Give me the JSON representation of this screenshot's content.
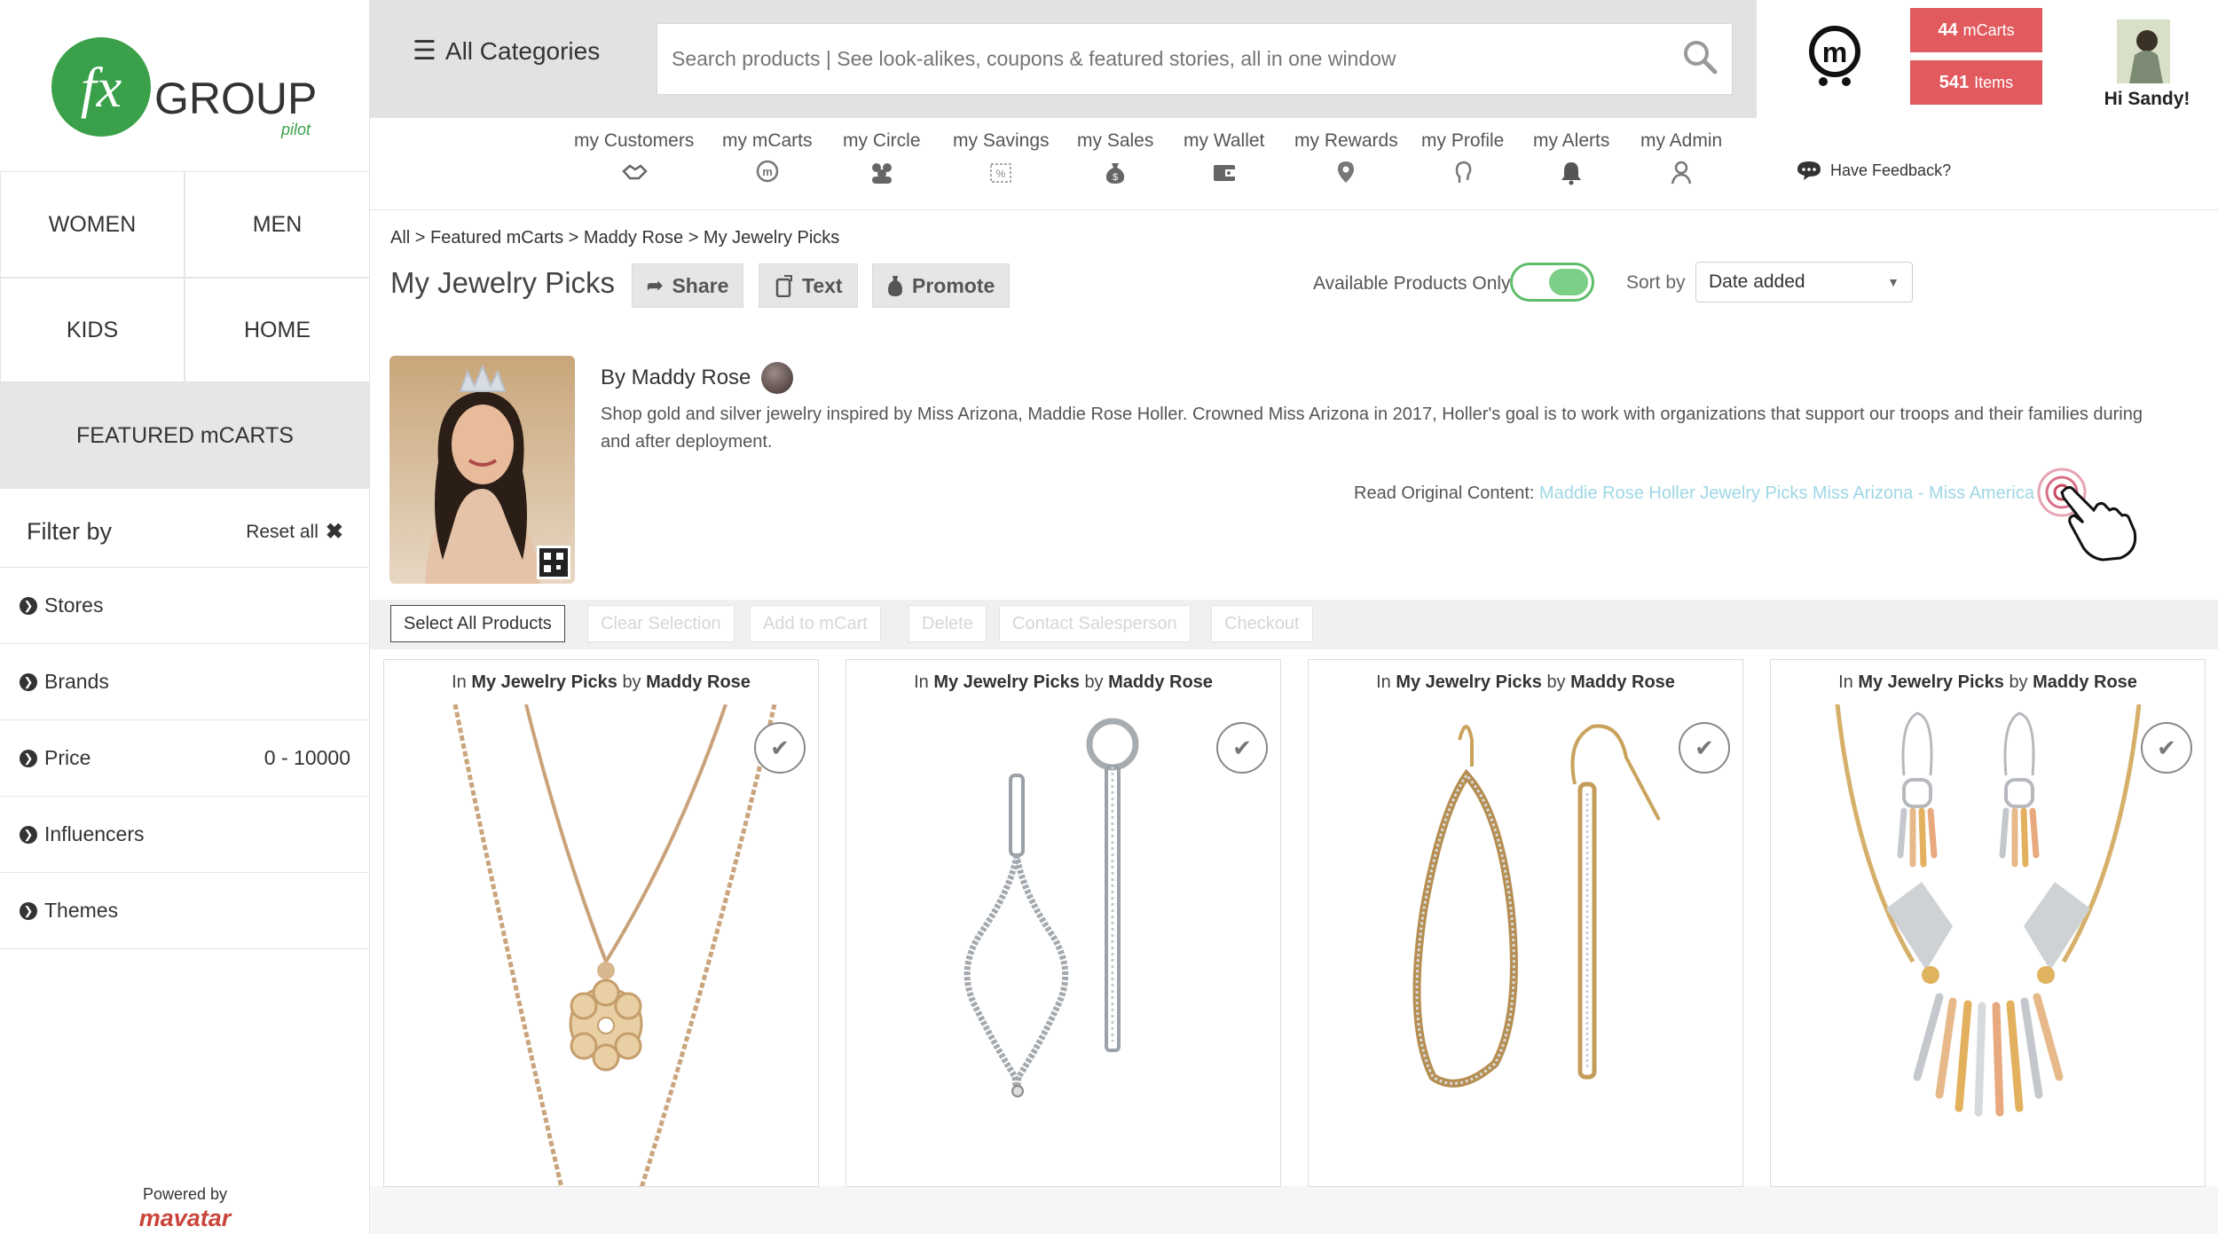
{
  "brand": {
    "logo_mark": "fx",
    "logo_word": "GROUP",
    "logo_sub": "pilot",
    "powered_by": "Powered by",
    "footer_brand": "mavatar"
  },
  "categories": [
    {
      "label": "WOMEN"
    },
    {
      "label": "MEN"
    },
    {
      "label": "KIDS"
    },
    {
      "label": "HOME"
    },
    {
      "label": "FEATURED mCARTS"
    }
  ],
  "filters": {
    "title": "Filter by",
    "reset_label": "Reset all",
    "items": [
      {
        "label": "Stores",
        "value": ""
      },
      {
        "label": "Brands",
        "value": ""
      },
      {
        "label": "Price",
        "value": "0 - 10000"
      },
      {
        "label": "Influencers",
        "value": ""
      },
      {
        "label": "Themes",
        "value": ""
      }
    ]
  },
  "header": {
    "all_categories": "All Categories",
    "search_placeholder": "Search products | See look-alikes, coupons & featured stories, all in one window",
    "mcarts_count": "44",
    "mcarts_label": "mCarts",
    "items_count": "541",
    "items_label": "Items",
    "greeting": "Hi Sandy!"
  },
  "nav": [
    {
      "label": "my Customers",
      "icon": "handshake-icon"
    },
    {
      "label": "my mCarts",
      "icon": "mcart-icon"
    },
    {
      "label": "my Circle",
      "icon": "group-icon"
    },
    {
      "label": "my Savings",
      "icon": "coupon-icon"
    },
    {
      "label": "my Sales",
      "icon": "money-bag-icon"
    },
    {
      "label": "my Wallet",
      "icon": "wallet-icon"
    },
    {
      "label": "my Rewards",
      "icon": "location-icon"
    },
    {
      "label": "my Profile",
      "icon": "profile-head-icon"
    },
    {
      "label": "my Alerts",
      "icon": "bell-icon"
    },
    {
      "label": "my Admin",
      "icon": "admin-icon"
    }
  ],
  "feedback_label": "Have Feedback?",
  "breadcrumb": "All > Featured mCarts > Maddy Rose > My Jewelry Picks",
  "page": {
    "title": "My Jewelry Picks",
    "share_label": "Share",
    "text_label": "Text",
    "promote_label": "Promote",
    "available_only_label": "Available Products Only",
    "available_only_on": true,
    "sort_label": "Sort by",
    "sort_value": "Date added"
  },
  "author": {
    "by_line": "By Maddy Rose",
    "description": "Shop gold and silver jewelry inspired by Miss Arizona, Maddie Rose Holler. Crowned Miss Arizona in 2017, Holler's goal is to work with organizations that support our troops and their families during and after deployment.",
    "read_original_label": "Read Original Content:",
    "read_original_link": "Maddie Rose Holler Jewelry Picks Miss Arizona - Miss America"
  },
  "selection_bar": {
    "select_all": "Select All Products",
    "clear": "Clear Selection",
    "add_to": "Add to mCart",
    "delete": "Delete",
    "contact": "Contact Salesperson",
    "checkout": "Checkout"
  },
  "products": [
    {
      "prefix": "In",
      "collection": "My Jewelry Picks",
      "by": "by",
      "author": "Maddy Rose",
      "kind": "gold-pendant-necklace"
    },
    {
      "prefix": "In",
      "collection": "My Jewelry Picks",
      "by": "by",
      "author": "Maddy Rose",
      "kind": "silver-drop-earrings"
    },
    {
      "prefix": "In",
      "collection": "My Jewelry Picks",
      "by": "by",
      "author": "Maddy Rose",
      "kind": "gold-hoop-earrings"
    },
    {
      "prefix": "In",
      "collection": "My Jewelry Picks",
      "by": "by",
      "author": "Maddy Rose",
      "kind": "multitone-necklace-set"
    }
  ],
  "colors": {
    "accent_red": "#e15a5e",
    "logo_green": "#3aa14a",
    "toggle_green": "#5ebd6a",
    "link_blue": "#9ed7e6"
  }
}
